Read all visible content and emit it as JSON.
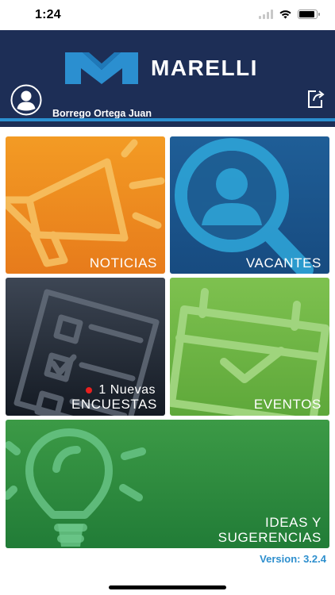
{
  "status_bar": {
    "time": "1:24"
  },
  "header": {
    "brand": "MARELLI",
    "user_name": "Borrego Ortega Juan"
  },
  "tiles": {
    "noticias": {
      "label": "NOTICIAS"
    },
    "vacantes": {
      "label": "VACANTES"
    },
    "encuestas": {
      "label": "ENCUESTAS",
      "badge": "1 Nuevas"
    },
    "eventos": {
      "label": "EVENTOS"
    },
    "ideas": {
      "label_line1": "IDEAS Y",
      "label_line2": "SUGERENCIAS"
    }
  },
  "footer": {
    "version": "Version: 3.2.4"
  },
  "colors": {
    "header": "#1d2e56",
    "accent": "#2b8fd0",
    "noticias": "#f08a1f",
    "vacantes": "#1b5589",
    "encuestas": "#262d38",
    "eventos": "#6db545",
    "ideas": "#2a8a3c",
    "version_text": "#2e8fce"
  }
}
